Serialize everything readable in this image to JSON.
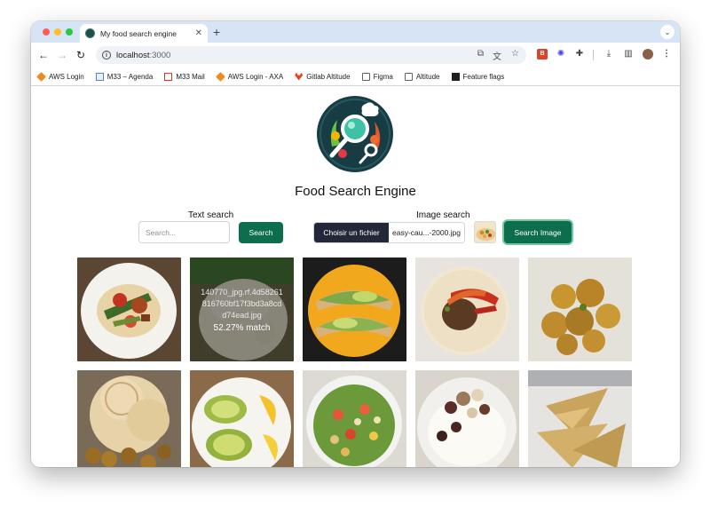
{
  "browser": {
    "tab_title": "My food search engine",
    "new_tab_label": "+",
    "url_host": "localhost",
    "url_rest": ":3000",
    "bookmarks": [
      {
        "label": "AWS Login",
        "icon": "aws-icon"
      },
      {
        "label": "M33 – Agenda",
        "icon": "calendar-icon"
      },
      {
        "label": "M33 Mail",
        "icon": "gmail-icon"
      },
      {
        "label": "AWS Login - AXA",
        "icon": "aws-icon"
      },
      {
        "label": "Gitlab Altitude",
        "icon": "gitlab-icon"
      },
      {
        "label": "Figma",
        "icon": "folder-icon"
      },
      {
        "label": "Altitude",
        "icon": "folder-icon"
      },
      {
        "label": "Feature flags",
        "icon": "flag-icon"
      }
    ]
  },
  "page": {
    "title": "Food Search Engine",
    "text_search": {
      "label": "Text search",
      "placeholder": "Search...",
      "value": "",
      "button": "Search"
    },
    "image_search": {
      "label": "Image search",
      "file_button": "Choisir un fichier",
      "file_name": "easy-cau...-2000.jpg",
      "button": "Search Image"
    },
    "results": [
      {
        "id": "r1",
        "label": "roasted vegetables on tortilla"
      },
      {
        "id": "r2",
        "label": "cauliflower",
        "hover": true,
        "filename": "140770_jpg.rf.4d58261816760bf17f3bd3a8cdd74ead.jpg",
        "score": "52.27% match"
      },
      {
        "id": "r3",
        "label": "tacos with avocado"
      },
      {
        "id": "r4",
        "label": "fajita tortilla"
      },
      {
        "id": "r5",
        "label": "fried cauliflower"
      },
      {
        "id": "r6",
        "label": "pita with falafel"
      },
      {
        "id": "r7",
        "label": "avocado halves with lemon"
      },
      {
        "id": "r8",
        "label": "chickpea salad"
      },
      {
        "id": "r9",
        "label": "rice bowl"
      },
      {
        "id": "r10",
        "label": "tortilla chips"
      }
    ]
  },
  "colors": {
    "accent_green": "#0d6e4e",
    "file_button_dark": "#22283a",
    "tab_strip": "#d6e4f5"
  }
}
